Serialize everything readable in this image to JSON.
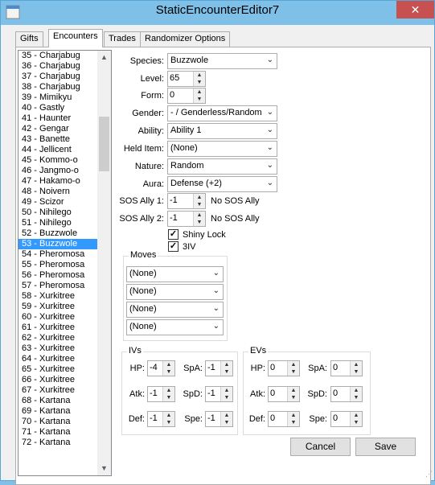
{
  "window": {
    "title": "StaticEncounterEditor7",
    "close_glyph": "✕"
  },
  "tabs": [
    {
      "label": "Gifts"
    },
    {
      "label": "Encounters"
    },
    {
      "label": "Trades"
    },
    {
      "label": "Randomizer Options"
    }
  ],
  "encounter_list": {
    "items": [
      "35 - Charjabug",
      "36 - Charjabug",
      "37 - Charjabug",
      "38 - Charjabug",
      "39 - Mimikyu",
      "40 - Gastly",
      "41 - Haunter",
      "42 - Gengar",
      "43 - Banette",
      "44 - Jellicent",
      "45 - Kommo-o",
      "46 - Jangmo-o",
      "47 - Hakamo-o",
      "48 - Noivern",
      "49 - Scizor",
      "50 - Nihilego",
      "51 - Nihilego",
      "52 - Buzzwole",
      "53 - Buzzwole",
      "54 - Pheromosa",
      "55 - Pheromosa",
      "56 - Pheromosa",
      "57 - Pheromosa",
      "58 - Xurkitree",
      "59 - Xurkitree",
      "60 - Xurkitree",
      "61 - Xurkitree",
      "62 - Xurkitree",
      "63 - Xurkitree",
      "64 - Xurkitree",
      "65 - Xurkitree",
      "66 - Xurkitree",
      "67 - Xurkitree",
      "68 - Kartana",
      "69 - Kartana",
      "70 - Kartana",
      "71 - Kartana",
      "72 - Kartana"
    ],
    "selected": "53 - Buzzwole"
  },
  "form": {
    "species": {
      "label": "Species:",
      "value": "Buzzwole"
    },
    "level": {
      "label": "Level:",
      "value": "65"
    },
    "form": {
      "label": "Form:",
      "value": "0"
    },
    "gender": {
      "label": "Gender:",
      "value": "- / Genderless/Random"
    },
    "ability": {
      "label": "Ability:",
      "value": "Ability 1"
    },
    "held_item": {
      "label": "Held Item:",
      "value": "(None)"
    },
    "nature": {
      "label": "Nature:",
      "value": "Random"
    },
    "aura": {
      "label": "Aura:",
      "value": "Defense (+2)"
    },
    "sos1": {
      "label": "SOS Ally 1:",
      "value": "-1",
      "desc": "No SOS Ally"
    },
    "sos2": {
      "label": "SOS Ally 2:",
      "value": "-1",
      "desc": "No SOS Ally"
    },
    "shiny_lock": {
      "label": "Shiny Lock",
      "checked": true
    },
    "three_iv": {
      "label": "3IV",
      "checked": true
    }
  },
  "moves": {
    "title": "Moves",
    "values": [
      "(None)",
      "(None)",
      "(None)",
      "(None)"
    ]
  },
  "ivs": {
    "title": "IVs",
    "hp": {
      "label": "HP:",
      "value": "-4"
    },
    "atk": {
      "label": "Atk:",
      "value": "-1"
    },
    "def": {
      "label": "Def:",
      "value": "-1"
    },
    "spa": {
      "label": "SpA:",
      "value": "-1"
    },
    "spd": {
      "label": "SpD:",
      "value": "-1"
    },
    "spe": {
      "label": "Spe:",
      "value": "-1"
    }
  },
  "evs": {
    "title": "EVs",
    "hp": {
      "label": "HP:",
      "value": "0"
    },
    "atk": {
      "label": "Atk:",
      "value": "0"
    },
    "def": {
      "label": "Def:",
      "value": "0"
    },
    "spa": {
      "label": "SpA:",
      "value": "0"
    },
    "spd": {
      "label": "SpD:",
      "value": "0"
    },
    "spe": {
      "label": "Spe:",
      "value": "0"
    }
  },
  "buttons": {
    "cancel": "Cancel",
    "save": "Save"
  },
  "icons": {
    "caret": "chevron-down-icon",
    "check": "checkmark-icon"
  },
  "glyphs": {
    "caret": "⌄",
    "up": "▲",
    "down": "▼",
    "check": "✓"
  }
}
